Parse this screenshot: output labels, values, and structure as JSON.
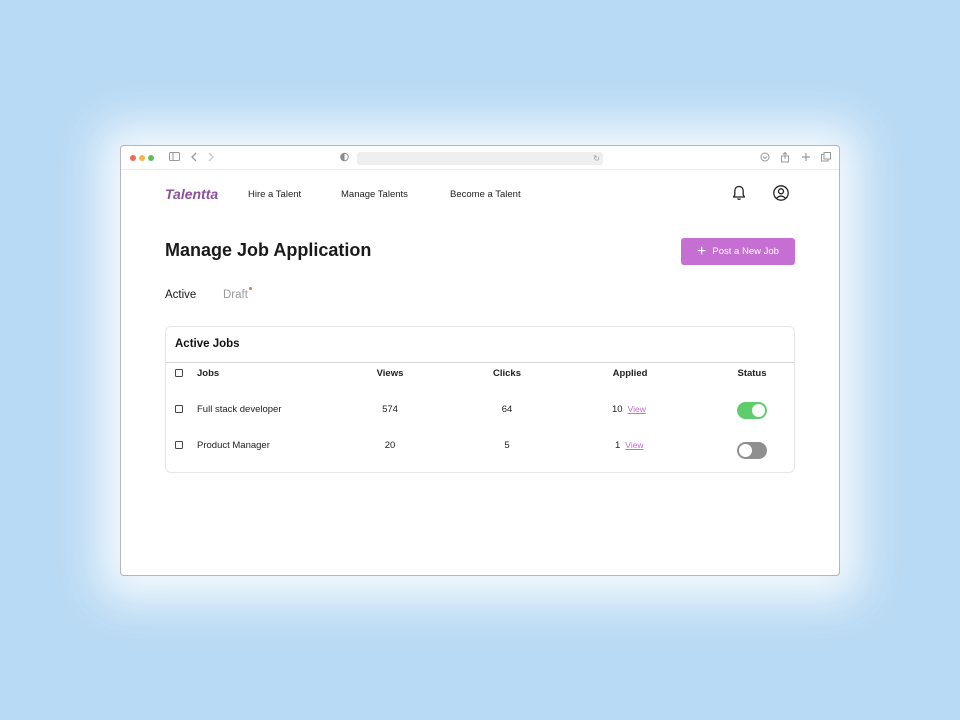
{
  "nav": {
    "logo": "Talentta",
    "links": [
      "Hire a Talent",
      "Manage Talents",
      "Become a Talent"
    ],
    "icons": [
      "bell-icon",
      "user-circle-icon"
    ]
  },
  "page": {
    "title": "Manage Job Application",
    "post_button": "Post a New Job"
  },
  "tabs": [
    {
      "label": "Active",
      "active": true
    },
    {
      "label": "Draft",
      "active": false
    }
  ],
  "card": {
    "title": "Active Jobs",
    "columns": [
      "Jobs",
      "Views",
      "Clicks",
      "Applied",
      "Status"
    ],
    "rows": [
      {
        "job": "Full stack developer",
        "views": "574",
        "clicks": "64",
        "applied": "10",
        "link": "View",
        "status": true
      },
      {
        "job": "Product Manager",
        "views": "20",
        "clicks": "5",
        "applied": "1",
        "link": "View",
        "status": false
      }
    ]
  },
  "colors": {
    "brand": "#8c4f9c",
    "accent": "#c56fd2",
    "toggle_on": "#5fcd6b",
    "toggle_off": "#8f8f8f",
    "background": "#b9daf4"
  }
}
